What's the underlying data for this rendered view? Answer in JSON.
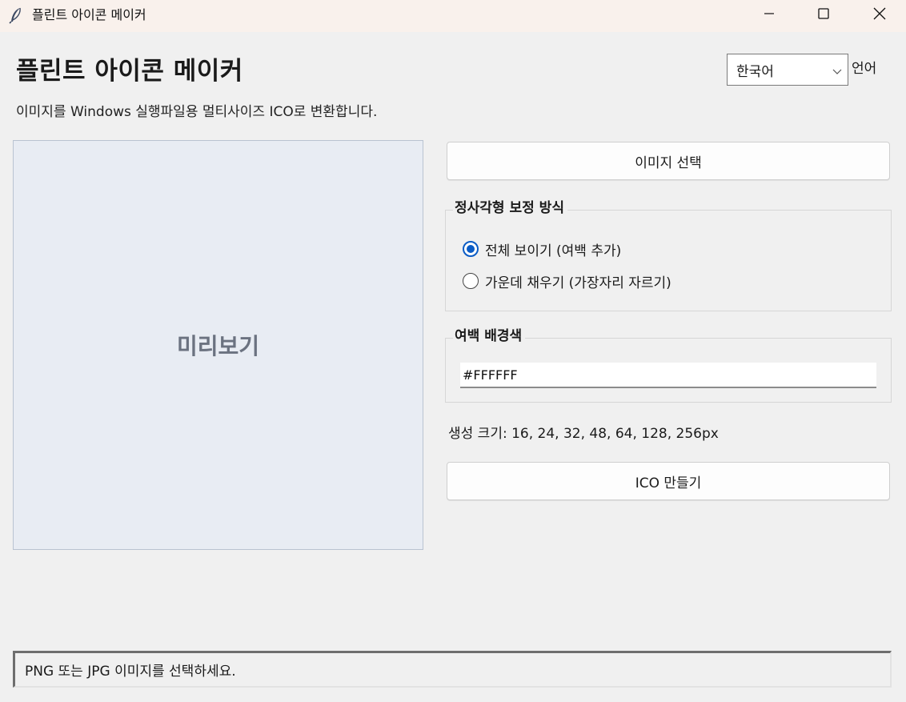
{
  "window": {
    "title": "플린트 아이콘 메이커"
  },
  "header": {
    "heading": "플린트 아이콘 메이커",
    "subtitle": "이미지를 Windows 실행파일용 멀티사이즈 ICO로 변환합니다.",
    "language_selected": "한국어",
    "language_label": "언어"
  },
  "preview": {
    "placeholder": "미리보기"
  },
  "actions": {
    "select_image_label": "이미지 선택",
    "make_ico_label": "ICO 만들기"
  },
  "mode_group": {
    "title": "정사각형 보정 방식",
    "options": [
      {
        "label": "전체 보이기 (여백 추가)",
        "checked": true
      },
      {
        "label": "가운데 채우기 (가장자리 자르기)",
        "checked": false
      }
    ]
  },
  "bg_group": {
    "title": "여백 배경색",
    "value": "#FFFFFF"
  },
  "sizes_text": "생성 크기: 16, 24, 32, 48, 64, 128, 256px",
  "status": {
    "message": "PNG 또는 JPG 이미지를 선택하세요."
  },
  "colors": {
    "accent": "#0b5cc5",
    "preview_bg": "#e8ecf3",
    "titlebar_bg": "#f9f1ec",
    "window_bg": "#f0f0f0"
  },
  "icons": {
    "app": "feather-icon",
    "minimize": "minimize-icon",
    "maximize": "maximize-icon",
    "close": "close-icon",
    "dropdown": "chevron-down-icon"
  }
}
